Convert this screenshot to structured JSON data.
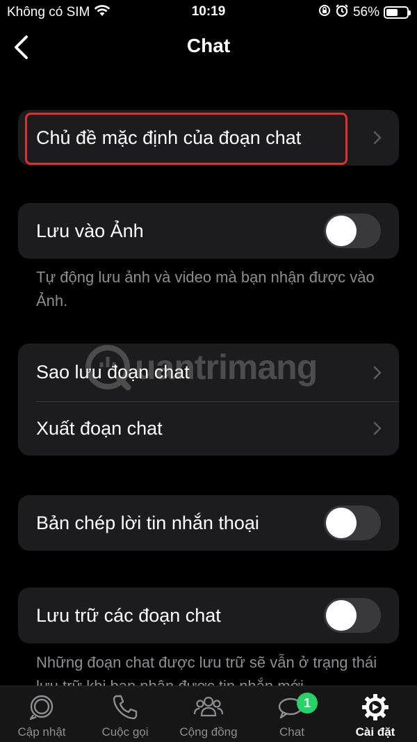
{
  "status_bar": {
    "carrier": "Không có SIM",
    "time": "10:19",
    "battery_percent": "56%",
    "battery_level": 0.56,
    "icons": [
      "wifi-icon",
      "orientation-lock-icon",
      "alarm-icon",
      "battery-icon"
    ]
  },
  "nav": {
    "title": "Chat",
    "back_icon": "chevron-left-icon"
  },
  "settings": {
    "default_theme": {
      "label": "Chủ đề mặc định của đoạn chat",
      "highlighted": true
    },
    "save_to_photos": {
      "label": "Lưu vào Ảnh",
      "enabled": false,
      "footer": "Tự động lưu ảnh và video mà bạn nhận được vào Ảnh."
    },
    "backup": {
      "label": "Sao lưu đoạn chat"
    },
    "export": {
      "label": "Xuất đoạn chat"
    },
    "voice_transcripts": {
      "label": "Bản chép lời tin nhắn thoại",
      "enabled": false
    },
    "archive": {
      "label": "Lưu trữ các đoạn chat",
      "enabled": false,
      "footer": "Những đoạn chat được lưu trữ sẽ vẫn ở trạng thái lưu trữ khi bạn nhận được tin nhắn mới"
    }
  },
  "watermark": {
    "text": "uantrimang"
  },
  "tab_bar": {
    "tabs": [
      {
        "label": "Cập nhật",
        "icon": "updates-icon",
        "active": false
      },
      {
        "label": "Cuộc gọi",
        "icon": "phone-icon",
        "active": false
      },
      {
        "label": "Cộng đồng",
        "icon": "communities-icon",
        "active": false
      },
      {
        "label": "Chat",
        "icon": "chat-bubbles-icon",
        "active": false,
        "badge": "1"
      },
      {
        "label": "Cài đặt",
        "icon": "settings-gear-icon",
        "active": true
      }
    ]
  },
  "colors": {
    "background": "#000000",
    "cell": "#1c1c1e",
    "secondary_text": "#8e8e93",
    "highlight": "#e0302d",
    "badge": "#25d366",
    "toggle_off": "#39393d"
  }
}
